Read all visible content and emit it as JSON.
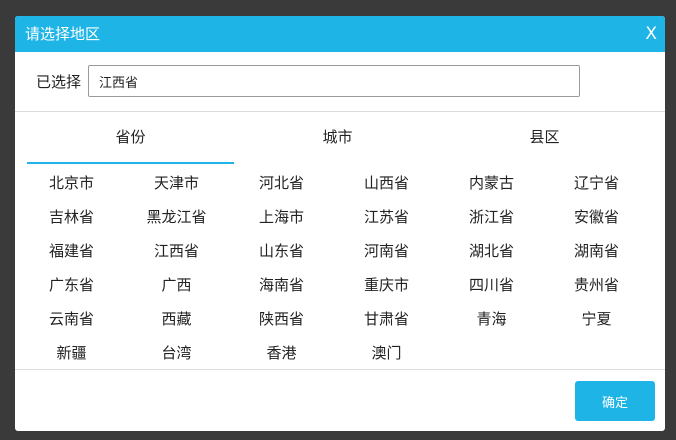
{
  "dialog": {
    "title": "请选择地区",
    "close_label": "X"
  },
  "selected": {
    "label": "已选择",
    "value": "江西省"
  },
  "tabs": [
    {
      "label": "省份",
      "active": true
    },
    {
      "label": "城市",
      "active": false
    },
    {
      "label": "县区",
      "active": false
    }
  ],
  "provinces": [
    "北京市",
    "天津市",
    "河北省",
    "山西省",
    "内蒙古",
    "辽宁省",
    "吉林省",
    "黑龙江省",
    "上海市",
    "江苏省",
    "浙江省",
    "安徽省",
    "福建省",
    "江西省",
    "山东省",
    "河南省",
    "湖北省",
    "湖南省",
    "广东省",
    "广西",
    "海南省",
    "重庆市",
    "四川省",
    "贵州省",
    "云南省",
    "西藏",
    "陕西省",
    "甘肃省",
    "青海",
    "宁夏",
    "新疆",
    "台湾",
    "香港",
    "澳门"
  ],
  "footer": {
    "confirm_label": "确定"
  },
  "colors": {
    "accent": "#1fb4e6",
    "overlay": "#3a3a3a"
  }
}
